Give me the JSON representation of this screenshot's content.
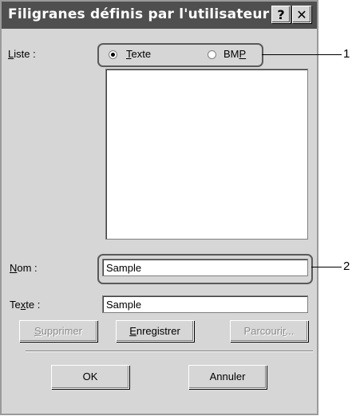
{
  "window": {
    "title": "Filigranes définis par l'utilisateur",
    "help_label": "?",
    "close_label": "✕"
  },
  "liste": {
    "label_pre": "L",
    "label_rest": "iste :",
    "radio_text": {
      "underlined": "T",
      "rest": "exte",
      "selected": true
    },
    "radio_bmp": {
      "pre": "BM",
      "underlined": "P",
      "selected": false
    },
    "items": []
  },
  "nom": {
    "label_underlined": "N",
    "label_rest": "om :",
    "value": "Sample"
  },
  "texte": {
    "label_pre": "Te",
    "label_underlined": "x",
    "label_rest": "te :",
    "value": "Sample"
  },
  "buttons": {
    "supprimer": {
      "underlined": "S",
      "rest": "upprimer",
      "enabled": false
    },
    "enregistrer": {
      "underlined": "E",
      "rest": "nregistrer",
      "enabled": true
    },
    "parcourir": {
      "pre": "Parcouri",
      "underlined": "r",
      "rest": "...",
      "enabled": false
    },
    "ok": "OK",
    "annuler": "Annuler"
  },
  "callouts": [
    "1",
    "2"
  ]
}
